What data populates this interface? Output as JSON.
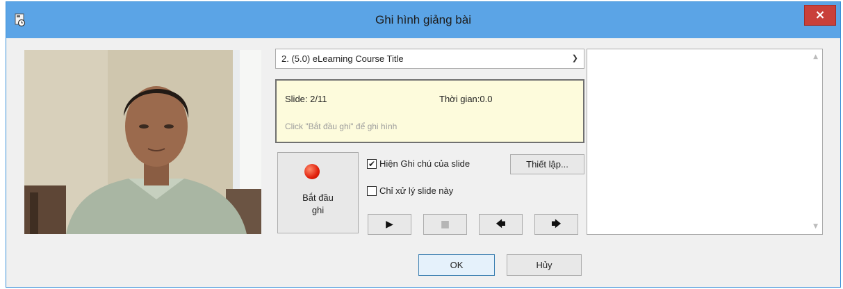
{
  "dialog": {
    "title": "Ghi hình giảng bài",
    "close_label": "×"
  },
  "presentation_select": {
    "value": "2. (5.0) eLearning Course Title"
  },
  "status": {
    "slide": "Slide: 2/11",
    "time": "Thời gian:0.0",
    "hint": "Click \"Bắt đầu ghi\" để ghi hình"
  },
  "record_button": {
    "line1": "Bắt đầu",
    "line2": "ghi"
  },
  "options": {
    "show_notes_label": "Hiện Ghi chú của slide",
    "show_notes_checked": true,
    "current_slide_only_label": "Chỉ xử lý slide này",
    "current_slide_only_checked": false,
    "settings_label": "Thiết lập..."
  },
  "controls": {
    "play": "▶",
    "stop": "■",
    "prev": "🡄",
    "next": "🡆"
  },
  "footer": {
    "ok_label": "OK",
    "cancel_label": "Hủy"
  }
}
